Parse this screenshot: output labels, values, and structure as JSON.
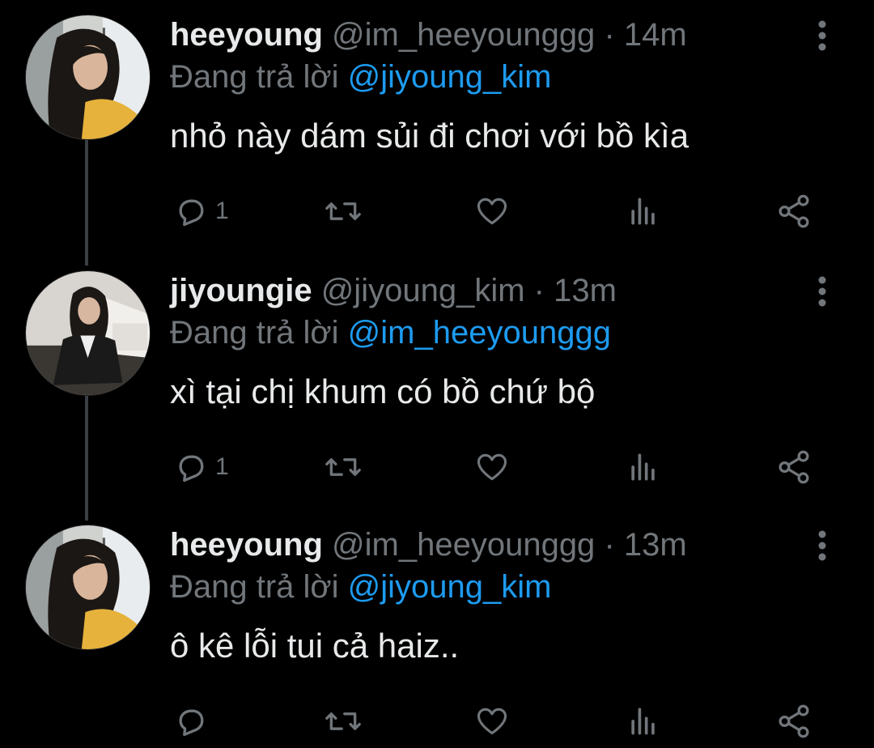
{
  "colors": {
    "background": "#000000",
    "text": "#e7e9ea",
    "muted": "#71767b",
    "mention": "#1d9bf0",
    "thread_line": "#3a3f44"
  },
  "tweets": [
    {
      "display_name": "heeyoung",
      "handle": "@im_heeyounggg",
      "separator": "·",
      "time": "14m",
      "replying_prefix": "Đang trả lời",
      "replying_to": "@jiyoung_kim",
      "text": "nhỏ này dám sủi đi chơi với bồ kìa",
      "reply_count": "1",
      "avatar": "heeyoung-avatar"
    },
    {
      "display_name": "jiyoungie",
      "handle": "@jiyoung_kim",
      "separator": "·",
      "time": "13m",
      "replying_prefix": "Đang trả lời",
      "replying_to": "@im_heeyounggg",
      "text": "xì tại chị khum có bồ chứ bộ",
      "reply_count": "1",
      "avatar": "jiyoung-avatar"
    },
    {
      "display_name": "heeyoung",
      "handle": "@im_heeyounggg",
      "separator": "·",
      "time": "13m",
      "replying_prefix": "Đang trả lời",
      "replying_to": "@jiyoung_kim",
      "text": "ô kê lỗi tui cả haiz..",
      "reply_count": "",
      "avatar": "heeyoung-avatar"
    }
  ]
}
